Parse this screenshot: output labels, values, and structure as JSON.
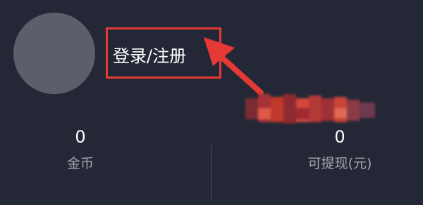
{
  "profile": {
    "login_label": "登录/注册"
  },
  "stats": [
    {
      "value": "0",
      "label": "金币"
    },
    {
      "value": "0",
      "label": "可提现(元)"
    }
  ],
  "colors": {
    "background": "#242836",
    "avatar_placeholder": "#5b5e6b",
    "annotation": "#e53935",
    "label_text": "#a3a6b2"
  },
  "icons": {
    "annotation_arrow": "red-arrow-icon"
  }
}
